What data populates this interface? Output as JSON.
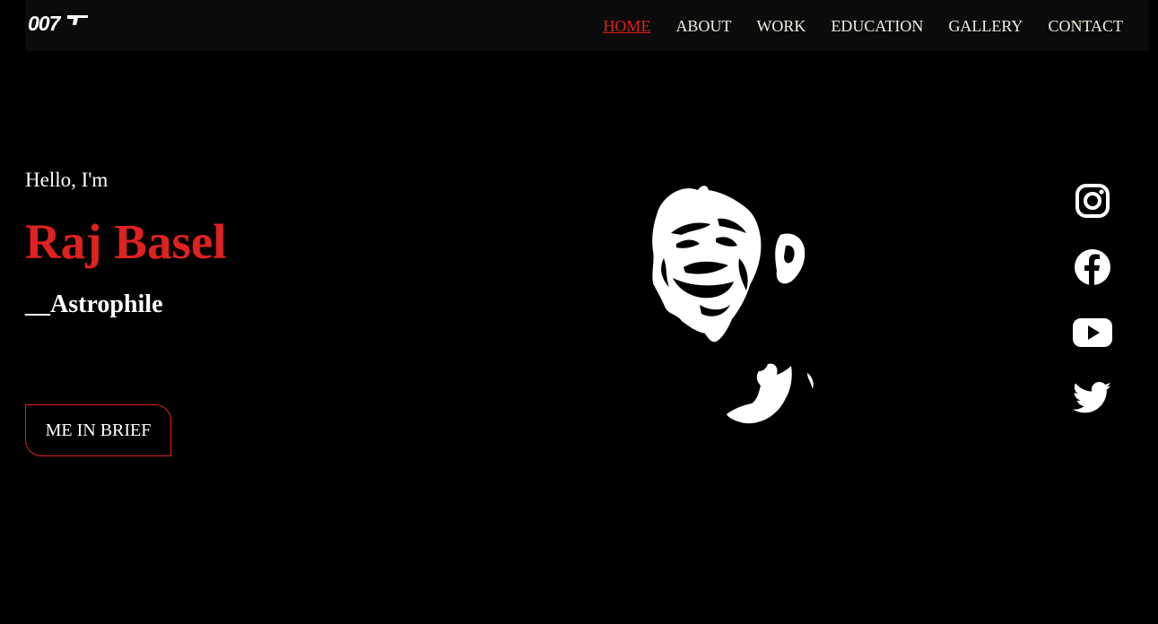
{
  "header": {
    "logo_text": "007",
    "nav": [
      {
        "label": "HOME",
        "active": true
      },
      {
        "label": "ABOUT",
        "active": false
      },
      {
        "label": "WORK",
        "active": false
      },
      {
        "label": "EDUCATION",
        "active": false
      },
      {
        "label": "GALLERY",
        "active": false
      },
      {
        "label": "CONTACT",
        "active": false
      }
    ]
  },
  "hero": {
    "greeting": "Hello, I'm",
    "name": "Raj Basel",
    "tagline": "__Astrophile",
    "cta_label": "ME IN BRIEF"
  },
  "social": [
    {
      "icon": "instagram-icon"
    },
    {
      "icon": "facebook-icon"
    },
    {
      "icon": "youtube-icon"
    },
    {
      "icon": "twitter-icon"
    }
  ],
  "colors": {
    "background": "#000000",
    "navbar": "#0b0b0b",
    "accent": "#e02121",
    "nav_text": "#f3efe3",
    "text": "#ffffff"
  }
}
